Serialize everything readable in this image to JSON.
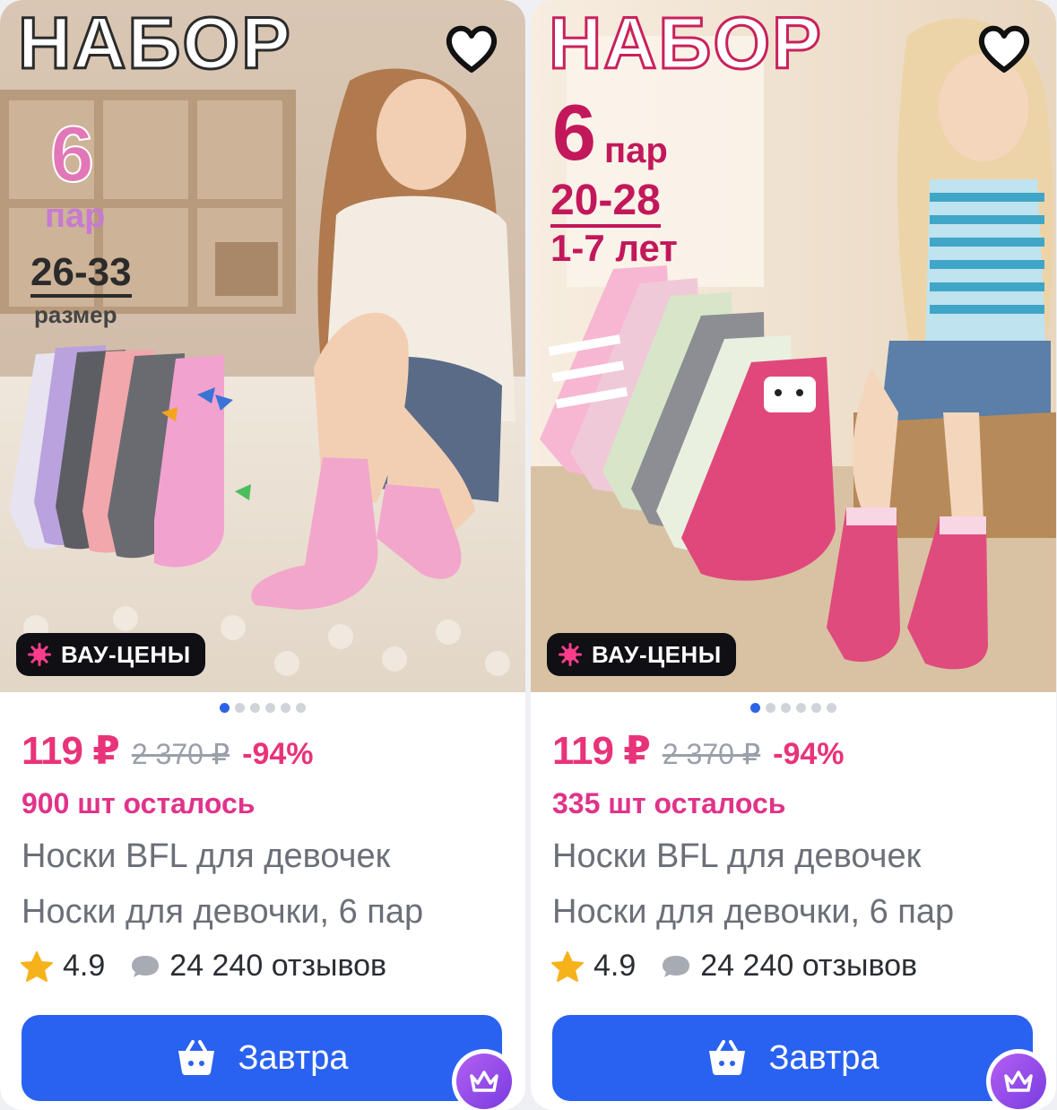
{
  "colors": {
    "accent_pink": "#e8337a",
    "primary_blue": "#2962f0",
    "text_gray": "#6b6f78",
    "badge_dark": "#0f0f14",
    "star_yellow": "#f6b21b"
  },
  "products": [
    {
      "overlay": {
        "title": "НАБОР",
        "count": "6",
        "pairs": "пар",
        "size": "26-33",
        "size_label": "размер"
      },
      "promo_badge": "ВАУ-ЦЕНЫ",
      "gallery": {
        "total": 6,
        "active": 0
      },
      "price": "119 ₽",
      "old_price": "2 370 ₽",
      "discount": "-94%",
      "stock": "900 шт осталось",
      "title_line1": "Носки BFL для девочек",
      "title_line2": "Носки для девочки, 6 пар",
      "rating": "4.9",
      "reviews": "24 240 отзывов",
      "cta": "Завтра",
      "icons": {
        "favorite": "heart-outline-icon",
        "promo": "burst-icon",
        "rating": "star-icon",
        "reviews": "chat-bubble-icon",
        "cta": "basket-icon",
        "badge": "crown-icon"
      }
    },
    {
      "overlay": {
        "title": "НАБОР",
        "count": "6",
        "pairs": "пар",
        "size": "20-28",
        "size_label": "1-7 лет"
      },
      "promo_badge": "ВАУ-ЦЕНЫ",
      "gallery": {
        "total": 6,
        "active": 0
      },
      "price": "119 ₽",
      "old_price": "2 370 ₽",
      "discount": "-94%",
      "stock": "335 шт осталось",
      "title_line1": "Носки BFL для девочек",
      "title_line2": "Носки для девочки, 6 пар",
      "rating": "4.9",
      "reviews": "24 240 отзывов",
      "cta": "Завтра",
      "icons": {
        "favorite": "heart-outline-icon",
        "promo": "burst-icon",
        "rating": "star-icon",
        "reviews": "chat-bubble-icon",
        "cta": "basket-icon",
        "badge": "crown-icon"
      }
    }
  ]
}
